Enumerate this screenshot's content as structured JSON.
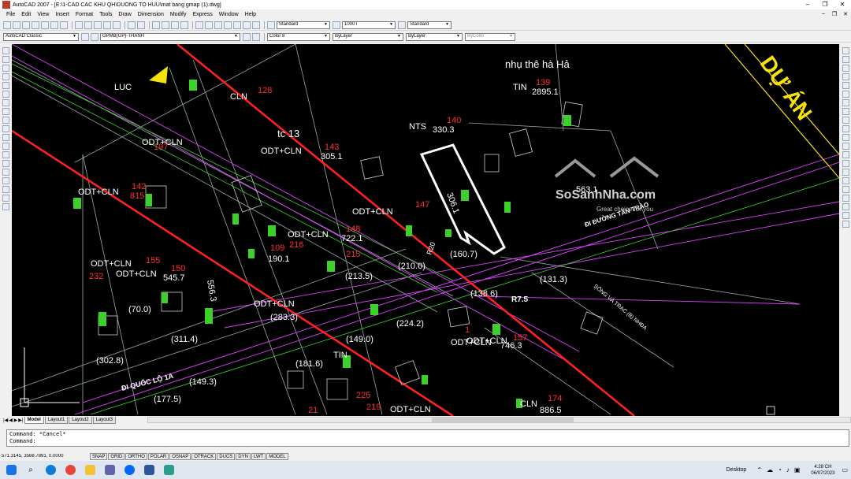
{
  "window": {
    "title": "AutoCAD 2007 - [E:\\1-CAD CAC KHU QH\\DUONG TO HUU\\mat bang gmap (1).dwg]",
    "controls": [
      "–",
      "❐",
      "✕"
    ]
  },
  "menu": {
    "items": [
      "File",
      "Edit",
      "View",
      "Insert",
      "Format",
      "Tools",
      "Draw",
      "Dimension",
      "Modify",
      "Express",
      "Window",
      "Help"
    ]
  },
  "toolbar": {
    "text_style": "Standard",
    "dim_style": "1000T",
    "table_style": "Standard",
    "workspace": "AutoCAD Classic",
    "layer": "GPMB(GP)-THANH",
    "color": "Color 8",
    "linetype": "ByLayer",
    "lineweight": "ByLayer",
    "plotstyle": "ByColor"
  },
  "drawing": {
    "labels_white": [
      {
        "t": "nhụ thê hà Hả"
      },
      {
        "t": "LUC"
      },
      {
        "t": "CLN"
      },
      {
        "t": "TIN"
      },
      {
        "t": "NTS"
      },
      {
        "t": "ODT+CLN"
      },
      {
        "t": "ODT+CLN"
      },
      {
        "t": "ODT+CLN"
      },
      {
        "t": "ODT+CLN"
      },
      {
        "t": "ODT+CLN"
      },
      {
        "t": "ODT+CLN"
      },
      {
        "t": "ODT+CLN"
      },
      {
        "t": "ODT+CLN"
      },
      {
        "t": "ODT+CLN"
      },
      {
        "t": "ODT+CLN"
      },
      {
        "t": "tc 13"
      },
      {
        "t": "(160.7)"
      },
      {
        "t": "(210.0)"
      },
      {
        "t": "(213.5)"
      },
      {
        "t": "(131.3)"
      },
      {
        "t": "(138.6)"
      },
      {
        "t": "(70.0)"
      },
      {
        "t": "(283.3)"
      },
      {
        "t": "(224.2)"
      },
      {
        "t": "(311.4)"
      },
      {
        "t": "(302.8)"
      },
      {
        "t": "(181.6)"
      },
      {
        "t": "(149.0)"
      },
      {
        "t": "(177.5)"
      },
      {
        "t": "(149.3)"
      },
      {
        "t": "ĐI QUỐC LỘ 1A"
      },
      {
        "t": "ĐI ĐƯỜNG TÂN TRÀO"
      },
      {
        "t": "R7.5"
      },
      {
        "t": "R20"
      },
      {
        "t": "746.3"
      },
      {
        "t": "545.7"
      },
      {
        "t": "556.3"
      },
      {
        "t": "722.1"
      },
      {
        "t": "190.1"
      },
      {
        "t": "2895.1"
      },
      {
        "t": "330.3"
      },
      {
        "t": "305.1"
      },
      {
        "t": "306.1"
      },
      {
        "t": "563.1"
      },
      {
        "t": "886.5"
      },
      {
        "t": "TIN"
      },
      {
        "t": "CLN"
      },
      {
        "t": "ODT+CLN"
      },
      {
        "t": "SÔNG VÀ TRẠC (B) NHĐA"
      }
    ],
    "labels_red": [
      {
        "t": "128"
      },
      {
        "t": "139"
      },
      {
        "t": "140"
      },
      {
        "t": "143"
      },
      {
        "t": "197"
      },
      {
        "t": "142"
      },
      {
        "t": "147"
      },
      {
        "t": "148"
      },
      {
        "t": "109"
      },
      {
        "t": "216"
      },
      {
        "t": "155"
      },
      {
        "t": "150"
      },
      {
        "t": "232"
      },
      {
        "t": "157"
      },
      {
        "t": "174"
      },
      {
        "t": "225"
      },
      {
        "t": "219"
      },
      {
        "t": "21"
      },
      {
        "t": "215"
      },
      {
        "t": "815"
      },
      {
        "t": "1"
      }
    ],
    "project_text": "DỰ ÁN",
    "watermark": {
      "brand": "SoSanhNha.com",
      "tagline": "Great choice for you"
    }
  },
  "layout_tabs": [
    "Model",
    "Layout1",
    "Layout2",
    "Layout3"
  ],
  "command": {
    "lines": [
      "Command: *Cancel*",
      "Command:"
    ]
  },
  "status": {
    "coords": "571.3145, 3568.7891, 0.0000",
    "buttons": [
      "SNAP",
      "GRID",
      "ORTHO",
      "POLAR",
      "OSNAP",
      "OTRACK",
      "DUCS",
      "DYN",
      "LWT",
      "MODEL"
    ]
  },
  "taskbar": {
    "desktop_label": "Desktop",
    "time": "4:28 CH",
    "date": "06/07/2023",
    "apps": [
      {
        "name": "windows-icon",
        "color": "#1a73e8"
      },
      {
        "name": "search-icon",
        "color": "#333333"
      },
      {
        "name": "edge-icon",
        "color": "#0f7bd6"
      },
      {
        "name": "chrome-icon",
        "color": "#e8453c"
      },
      {
        "name": "explorer-icon",
        "color": "#f2c233"
      },
      {
        "name": "store-icon",
        "color": "#6264a7"
      },
      {
        "name": "zalo-icon",
        "color": "#0068ff"
      },
      {
        "name": "word-icon",
        "color": "#2b579a"
      },
      {
        "name": "autocad-icon",
        "color": "#2a9d8f"
      }
    ]
  },
  "colors": {
    "canvas_bg": "#000000",
    "road_red": "#ff2020",
    "cad_green": "#3bd12a",
    "cad_yellow": "#f5e20a",
    "cad_magenta": "#e040ff",
    "cad_white": "#ffffff"
  }
}
